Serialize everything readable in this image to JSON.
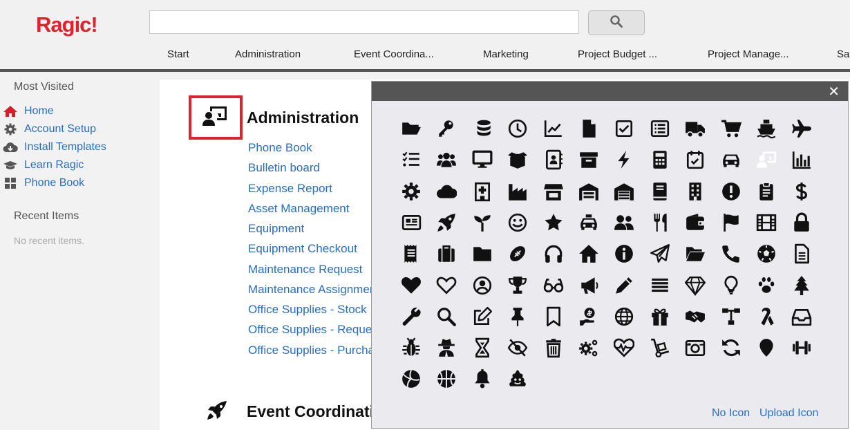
{
  "app": {
    "logo": "Ragic!"
  },
  "search": {
    "placeholder": ""
  },
  "tabs": [
    "Start",
    "Administration",
    "Event Coordina...",
    "Marketing",
    "Project Budget ...",
    "Project Manage...",
    "Sal"
  ],
  "sidebar": {
    "most_visited": "Most Visited",
    "items": [
      {
        "label": "Home",
        "icon": "home-icon"
      },
      {
        "label": "Account Setup",
        "icon": "gear-icon"
      },
      {
        "label": "Install Templates",
        "icon": "cloud-download-icon"
      },
      {
        "label": "Learn Ragic",
        "icon": "graduation-cap-icon"
      },
      {
        "label": "Phone Book",
        "icon": "grid-icon"
      }
    ],
    "recent_items": "Recent Items",
    "no_recent": "No recent items."
  },
  "main": {
    "section1_title": "Administration",
    "section1_links": [
      "Phone Book",
      "Bulletin board",
      "Expense Report",
      "Asset Management",
      "Equipment",
      "Equipment Checkout",
      "Maintenance Request",
      "Maintenance Assignment",
      "Office Supplies - Stock",
      "Office Supplies - Request",
      "Office Supplies - Purchase"
    ],
    "section2_title": "Event Coordination"
  },
  "icon_picker": {
    "close": "✕",
    "no_icon": "No Icon",
    "upload_icon": "Upload Icon",
    "selected": "presentation-icon",
    "icons": [
      "folder-open",
      "key",
      "coins",
      "clock",
      "chart-line",
      "file",
      "check-square",
      "list-alt",
      "truck",
      "cart",
      "ship",
      "plane",
      "tasks",
      "users",
      "desktop",
      "box-open",
      "address-book",
      "archive",
      "bolt",
      "calculator",
      "calendar-check",
      "car",
      "presentation",
      "chart-bar",
      "cog",
      "cloud",
      "hospital",
      "industry",
      "store",
      "warehouse",
      "garage",
      "book",
      "building",
      "exclamation-circle",
      "clipboard",
      "dollar",
      "newspaper",
      "rocket",
      "seedling",
      "smile",
      "star",
      "taxi",
      "user-friends",
      "utensils",
      "wallet",
      "flag",
      "film",
      "lock",
      "receipt",
      "suitcase",
      "folder",
      "football",
      "headphones",
      "home",
      "info-circle",
      "paper-plane",
      "folder-open-2",
      "phone",
      "soccer-ball",
      "file-alt",
      "heart",
      "heart-outline",
      "user-circle",
      "trophy",
      "glasses",
      "bullhorn",
      "pencil",
      "align-justify",
      "gem",
      "lightbulb",
      "paw",
      "tree",
      "wrench",
      "search",
      "edit",
      "thumbtack",
      "bookmark",
      "hand-holding-usd",
      "globe",
      "gift",
      "handshake",
      "sitemap",
      "ribbon",
      "inbox",
      "bug",
      "user-secret",
      "hourglass",
      "eye-slash",
      "trash",
      "cogs",
      "heartbeat",
      "dolly",
      "camera-retro",
      "sync",
      "map-marker",
      "dumbbell",
      "volleyball",
      "basketball",
      "bell",
      "poop"
    ]
  }
}
